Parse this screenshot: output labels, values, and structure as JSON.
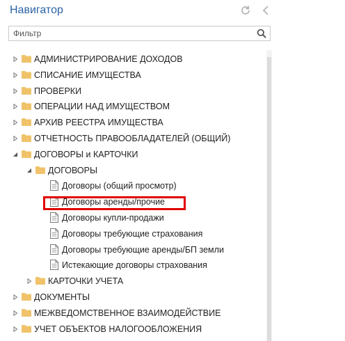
{
  "header": {
    "title": "Навигатор"
  },
  "filter": {
    "placeholder": "Фильтр",
    "value": ""
  },
  "tree": [
    {
      "label": "АДМИНИСТРИРОВАНИЕ ДОХОДОВ",
      "type": "folder",
      "expanded": false,
      "level": 0
    },
    {
      "label": "СПИСАНИЕ ИМУЩЕСТВА",
      "type": "folder",
      "expanded": false,
      "level": 0
    },
    {
      "label": "ПРОВЕРКИ",
      "type": "folder",
      "expanded": false,
      "level": 0
    },
    {
      "label": "ОПЕРАЦИИ НАД ИМУЩЕСТВОМ",
      "type": "folder",
      "expanded": false,
      "level": 0
    },
    {
      "label": "АРХИВ РЕЕСТРА ИМУЩЕСТВА",
      "type": "folder",
      "expanded": false,
      "level": 0
    },
    {
      "label": "ОТЧЕТНОСТЬ ПРАВООБЛАДАТЕЛЕЙ (ОБЩИЙ)",
      "type": "folder",
      "expanded": false,
      "level": 0
    },
    {
      "label": "ДОГОВОРЫ и КАРТОЧКИ",
      "type": "folder",
      "expanded": true,
      "level": 0
    },
    {
      "label": "ДОГОВОРЫ",
      "type": "folder",
      "expanded": true,
      "level": 1
    },
    {
      "label": "Договоры (общий просмотр)",
      "type": "doc",
      "level": 2
    },
    {
      "label": "Договоры аренды/прочие",
      "type": "doc",
      "level": 2,
      "highlighted": true
    },
    {
      "label": "Договоры купли-продажи",
      "type": "doc",
      "level": 2
    },
    {
      "label": "Договоры требующие страхования",
      "type": "doc",
      "level": 2
    },
    {
      "label": "Договоры требующие аренды/БП земли",
      "type": "doc",
      "level": 2
    },
    {
      "label": "Истекающие договоры страхования",
      "type": "doc",
      "level": 2
    },
    {
      "label": "КАРТОЧКИ УЧЕТА",
      "type": "folder",
      "expanded": false,
      "level": 1
    },
    {
      "label": "ДОКУМЕНТЫ",
      "type": "folder",
      "expanded": false,
      "level": 0
    },
    {
      "label": "МЕЖВЕДОМСТВЕННОЕ ВЗАИМОДЕЙСТВИЕ",
      "type": "folder",
      "expanded": false,
      "level": 0
    },
    {
      "label": "УЧЕТ ОБЪЕКТОВ НАЛОГООБЛОЖЕНИЯ",
      "type": "folder",
      "expanded": false,
      "level": 0
    }
  ],
  "colors": {
    "title": "#2a63a6",
    "folder": "#f0c36a",
    "highlight_border": "#e00000"
  }
}
